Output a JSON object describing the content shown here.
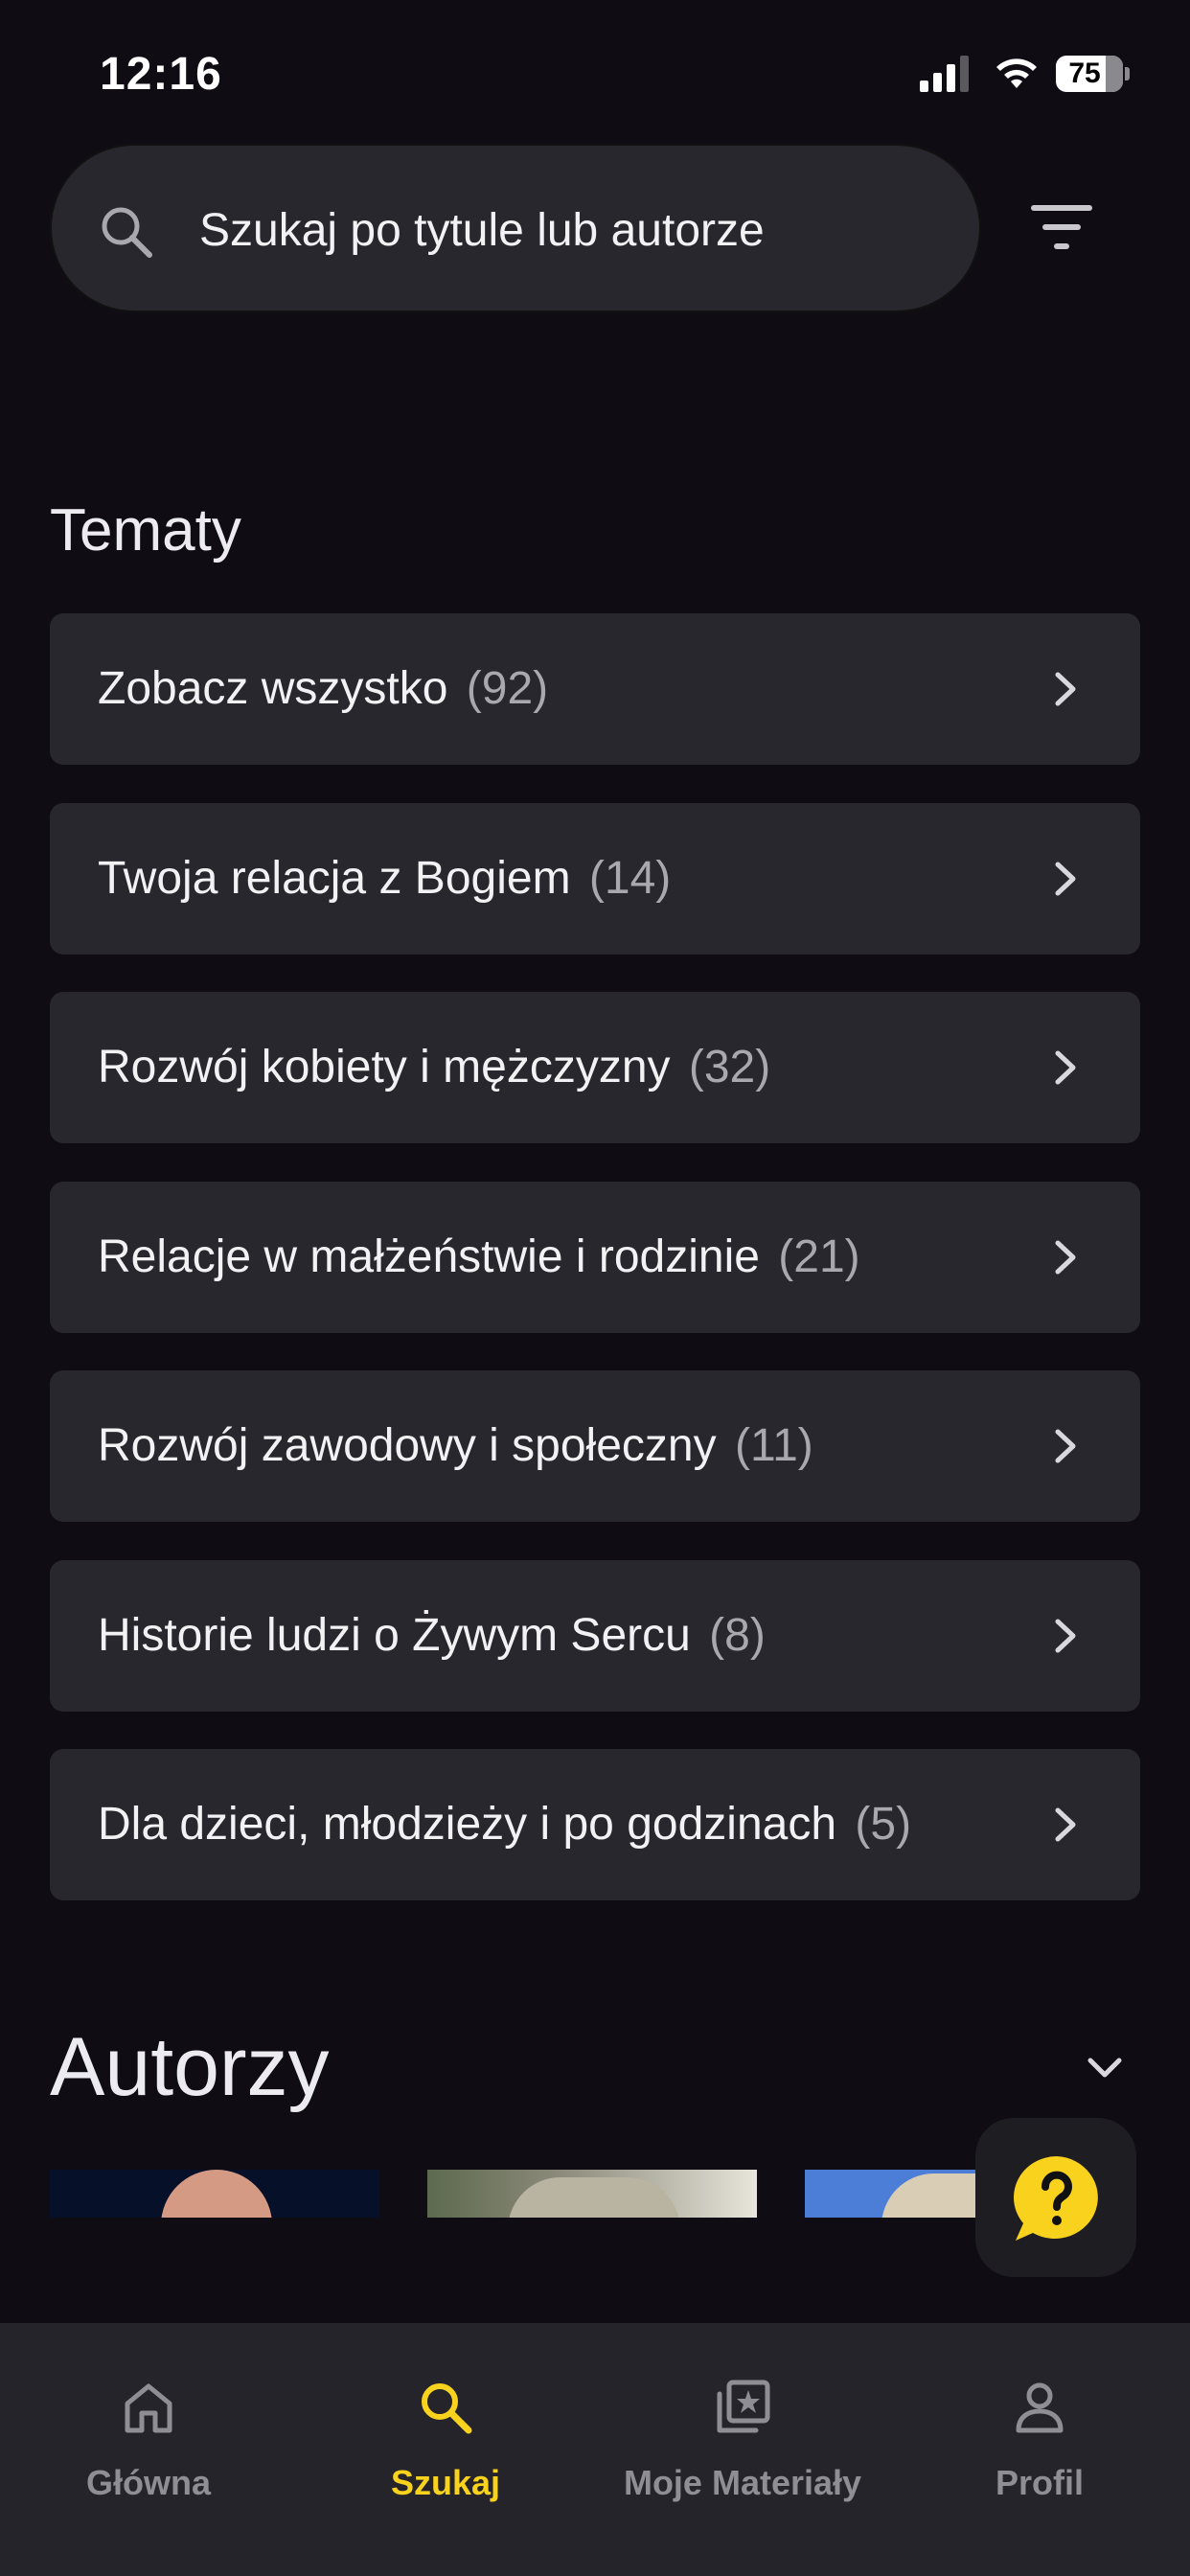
{
  "status_bar": {
    "time": "12:16",
    "battery": "75",
    "battery_level": 0.75
  },
  "search": {
    "placeholder": "Szukaj po tytule lub autorze"
  },
  "topics": {
    "title": "Tematy",
    "items": [
      {
        "label": "Zobacz wszystko",
        "count": "(92)"
      },
      {
        "label": "Twoja relacja z Bogiem",
        "count": "(14)"
      },
      {
        "label": "Rozwój kobiety i mężczyzny",
        "count": "(32)"
      },
      {
        "label": "Relacje w małżeństwie i rodzinie",
        "count": "(21)"
      },
      {
        "label": "Rozwój zawodowy i społeczny",
        "count": "(11)"
      },
      {
        "label": "Historie ludzi o Żywym Sercu",
        "count": "(8)"
      },
      {
        "label": "Dla dzieci, młodzieży i po godzinach",
        "count": "(5)"
      }
    ]
  },
  "authors": {
    "title": "Autorzy"
  },
  "bottom_nav": {
    "items": [
      {
        "label": "Główna",
        "icon": "home-icon"
      },
      {
        "label": "Szukaj",
        "icon": "search-icon",
        "active": true
      },
      {
        "label": "Moje Materiały",
        "icon": "materials-icon"
      },
      {
        "label": "Profil",
        "icon": "profile-icon"
      }
    ]
  },
  "colors": {
    "background": "#0f0d13",
    "card": "#28272d",
    "accent": "#f8d21c",
    "muted": "#8f8e94"
  }
}
